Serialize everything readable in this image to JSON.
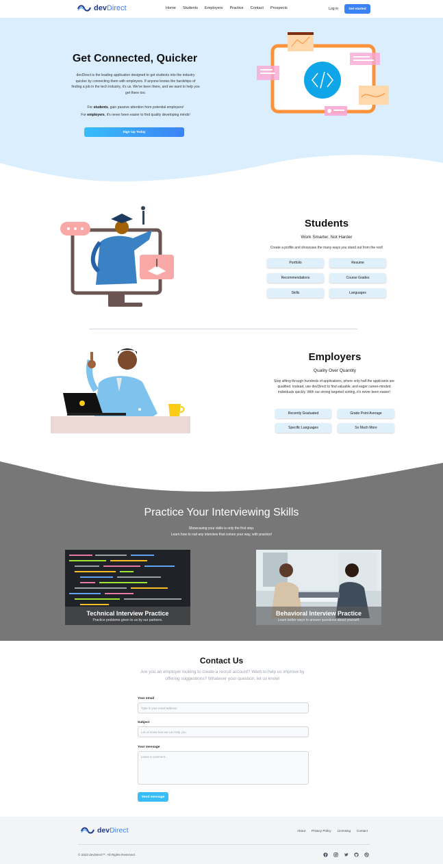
{
  "brand": {
    "name_dev": "dev",
    "name_direct": "Direct",
    "primary_color": "#3b82f6",
    "navy": "#1e3a8a"
  },
  "nav": {
    "links": [
      "Home",
      "Students",
      "Employers",
      "Practice",
      "Contact",
      "Prospects"
    ],
    "login": "Log in",
    "cta": "Get started"
  },
  "hero": {
    "title": "Get Connected, Quicker",
    "description": "devDirect is the leading application designed to get students into the industry quicker by connecting them with employers. If anyone knows the hardships of finding a job in the tech industry, it's us. We've been there, and we want to help you get there too.",
    "students_prefix": "For ",
    "students_bold": "students",
    "students_rest": ", gain passive attention from potential employers!",
    "employers_prefix": "For ",
    "employers_bold": "employers",
    "employers_rest": ", it's never been easier to find quality developing minds!",
    "button": "Sign Up Today",
    "bg_color": "#dbeefe"
  },
  "students": {
    "title": "Students",
    "subtitle": "Work Smarter, Not Harder",
    "description": "Create a profile and showcase the many ways you stand out from the rest!",
    "features": [
      "Portfolio",
      "Resume",
      "Recommendations",
      "Course Grades",
      "Skills",
      "Languages"
    ]
  },
  "employers": {
    "title": "Employers",
    "subtitle": "Quality Over Quantity",
    "description": "Stop sifting through hundreds of applications, where only half the applicants are qualified. Instead, use devDirect to find valuable, and eager career-minded individuals quickly. With our strong targeted sorting, it's never been easier!",
    "features": [
      "Recently Graduated",
      "Grade Point Average",
      "Specific Languages",
      "So Much More"
    ]
  },
  "practice": {
    "title": "Practice Your Interviewing Skills",
    "subtitle_1": "Showcasing your skills is only the first step.",
    "subtitle_2": "Learn how to nail any interview that comes your way, with practice!",
    "bg_color": "#777777",
    "cards": [
      {
        "title": "Technical Interview Practice",
        "subtitle": "Practice problems given to us by our partners."
      },
      {
        "title": "Behavioral Interview Practice",
        "subtitle": "Learn better ways to answer questions about yourself."
      }
    ]
  },
  "contact": {
    "title": "Contact Us",
    "description": "Are you an employer looking to create a recruit account? Want to help us improve by offering suggestions? Whatever your question, let us know!",
    "email_label": "Your email",
    "email_placeholder": "Type in your email address",
    "subject_label": "Subject",
    "subject_placeholder": "Let us know how we can help you",
    "message_label": "Your message",
    "message_placeholder": "Leave a comment...",
    "button": "Send message"
  },
  "footer": {
    "links": [
      "About",
      "Privacy Policy",
      "Licensing",
      "Contact"
    ],
    "copyright": "© 2023 devDirect™. All Rights Reserved.",
    "social_icons": [
      "facebook-icon",
      "instagram-icon",
      "twitter-icon",
      "github-icon",
      "dribbble-icon"
    ]
  }
}
